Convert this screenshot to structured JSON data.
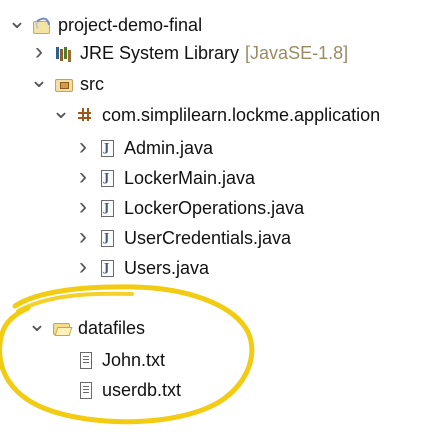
{
  "tree": {
    "project": {
      "label": "project-demo-final",
      "icon": "project-folder-icon"
    },
    "library": {
      "label": "JRE System Library",
      "decoration": "[JavaSE-1.8]",
      "icon": "library-icon"
    },
    "source_folder": {
      "label": "src",
      "icon": "source-folder-icon"
    },
    "package": {
      "label": "com.simplilearn.lockme.application",
      "icon": "package-icon"
    },
    "java_files": [
      {
        "label": "Admin.java",
        "icon": "java-file-icon"
      },
      {
        "label": "LockerMain.java",
        "icon": "java-file-icon"
      },
      {
        "label": "LockerOperations.java",
        "icon": "java-file-icon"
      },
      {
        "label": "UserCredentials.java",
        "icon": "java-file-icon"
      },
      {
        "label": "Users.java",
        "icon": "java-file-icon"
      }
    ],
    "datafiles_folder": {
      "label": "datafiles",
      "icon": "open-folder-icon"
    },
    "data_files": [
      {
        "label": "John.txt",
        "icon": "text-file-icon"
      },
      {
        "label": "userdb.txt",
        "icon": "text-file-icon"
      }
    ]
  },
  "annotation": {
    "highlight_color": "#f2cc12"
  }
}
